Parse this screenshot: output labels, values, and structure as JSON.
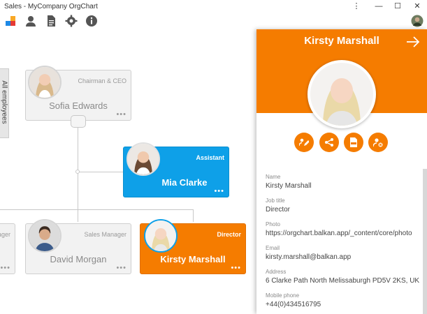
{
  "window": {
    "title": "Sales - MyCompany OrgChart",
    "controls": {
      "menu": "⋮",
      "minimize": "—",
      "maximize": "☐",
      "close": "✕"
    }
  },
  "toolbar": {
    "icons": [
      "logo-icon",
      "user-icon",
      "document-icon",
      "gear-icon",
      "info-icon"
    ]
  },
  "sidebar": {
    "all_employees": "All employees"
  },
  "nodes": {
    "ceo": {
      "name": "Sofia Edwards",
      "role": "Chairman & CEO"
    },
    "assistant": {
      "name": "Mia Clarke",
      "role": "Assistant"
    },
    "left": {
      "role": "ager"
    },
    "sales_manager": {
      "name": "David Morgan",
      "role": "Sales Manager"
    },
    "director": {
      "name": "Kirsty Marshall",
      "role": "Director"
    },
    "dots": "•••"
  },
  "panel": {
    "name": "Kirsty Marshall",
    "fields": [
      {
        "label": "Name",
        "value": "Kirsty Marshall"
      },
      {
        "label": "Job title",
        "value": "Director"
      },
      {
        "label": "Photo",
        "value": "https://orgchart.balkan.app/_content/core/photo"
      },
      {
        "label": "Email",
        "value": "kirsty.marshall@balkan.app"
      },
      {
        "label": "Address",
        "value": "6 Clarke Path North Melissaburgh PD5V 2KS, UK"
      },
      {
        "label": "Mobile phone",
        "value": "+44(0)434516795"
      }
    ]
  },
  "colors": {
    "accent": "#f57c00",
    "assistant_blue": "#0ea0e8",
    "node_gray": "#f2f2f2"
  }
}
